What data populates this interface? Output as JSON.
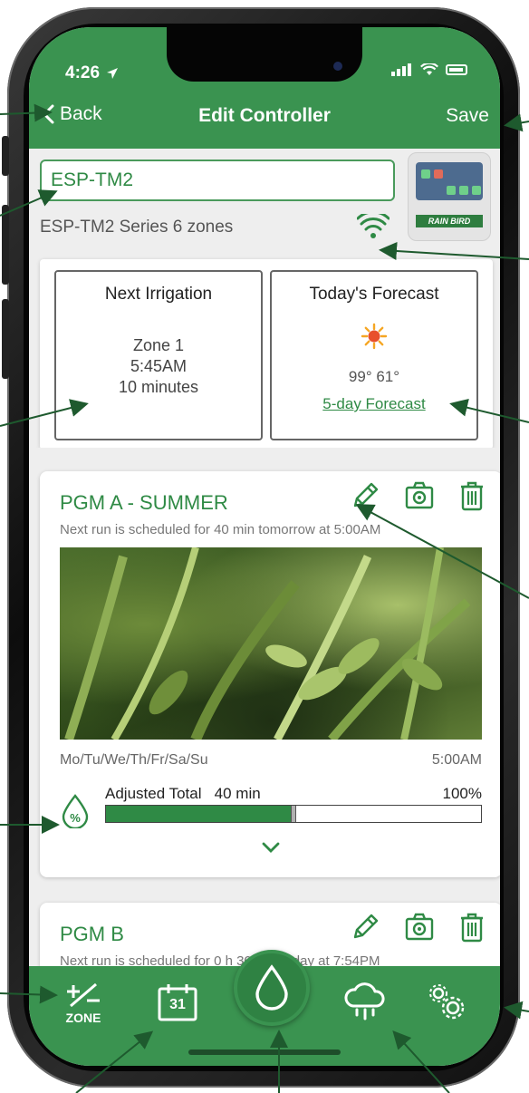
{
  "status": {
    "time": "4:26"
  },
  "nav": {
    "back_label": "Back",
    "title": "Edit Controller",
    "save_label": "Save"
  },
  "controller": {
    "name_value": "ESP-TM2",
    "series_text": "ESP-TM2 Series  6 zones",
    "brand_text": "RAIN BIRD"
  },
  "next_irrigation": {
    "heading": "Next Irrigation",
    "zone": "Zone 1",
    "time": "5:45AM",
    "duration": "10 minutes"
  },
  "forecast": {
    "heading": "Today's Forecast",
    "temps": "99° 61°",
    "link_label": "5-day Forecast"
  },
  "programs": [
    {
      "title": "PGM A - SUMMER",
      "next_run": "Next run is scheduled for 40 min tomorrow at 5:00AM",
      "days": "Mo/Tu/We/Th/Fr/Sa/Su",
      "start_time": "5:00AM",
      "adjusted_label": "Adjusted Total",
      "adjusted_minutes": "40 min",
      "adjust_percent_label": "100%",
      "adjust_fill_fraction": 0.5
    },
    {
      "title": "PGM B",
      "next_run": "Next run is scheduled for 0 h 30 min today at 7:54PM"
    }
  ],
  "tabbar": {
    "zone_label": "ZONE",
    "calendar_day": "31"
  },
  "colors": {
    "brand_green": "#3a9350",
    "accent_green": "#2f8a45"
  }
}
